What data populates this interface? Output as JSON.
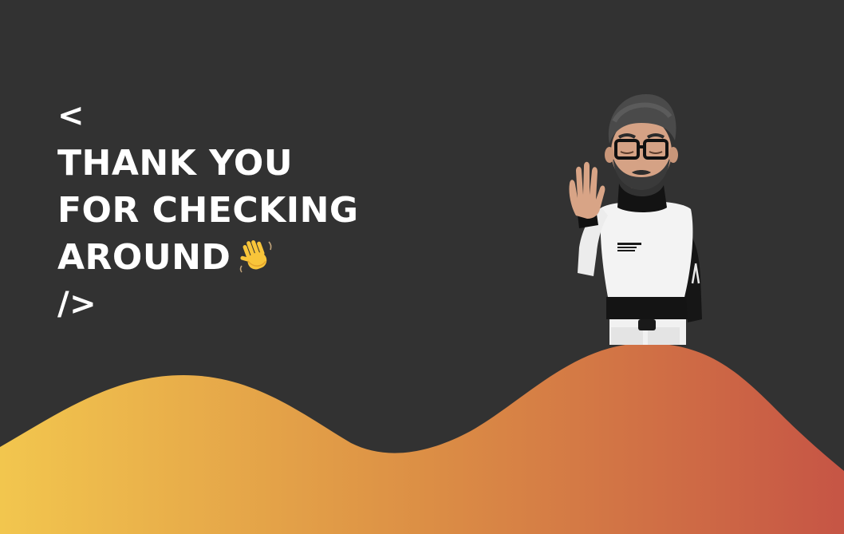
{
  "headline": {
    "open_tag": "<",
    "line1": "THANK YOU",
    "line2": "FOR CHECKING",
    "line3": "AROUND",
    "close_tag": "/>",
    "emoji": "waving-hand-icon"
  },
  "colors": {
    "background": "#323232",
    "text": "#ffffff",
    "wave_start": "#f2c64e",
    "wave_mid": "#dc8f45",
    "wave_end": "#c65545"
  },
  "avatar": {
    "shirt_print": "WE MAKE IN EPICUS"
  }
}
